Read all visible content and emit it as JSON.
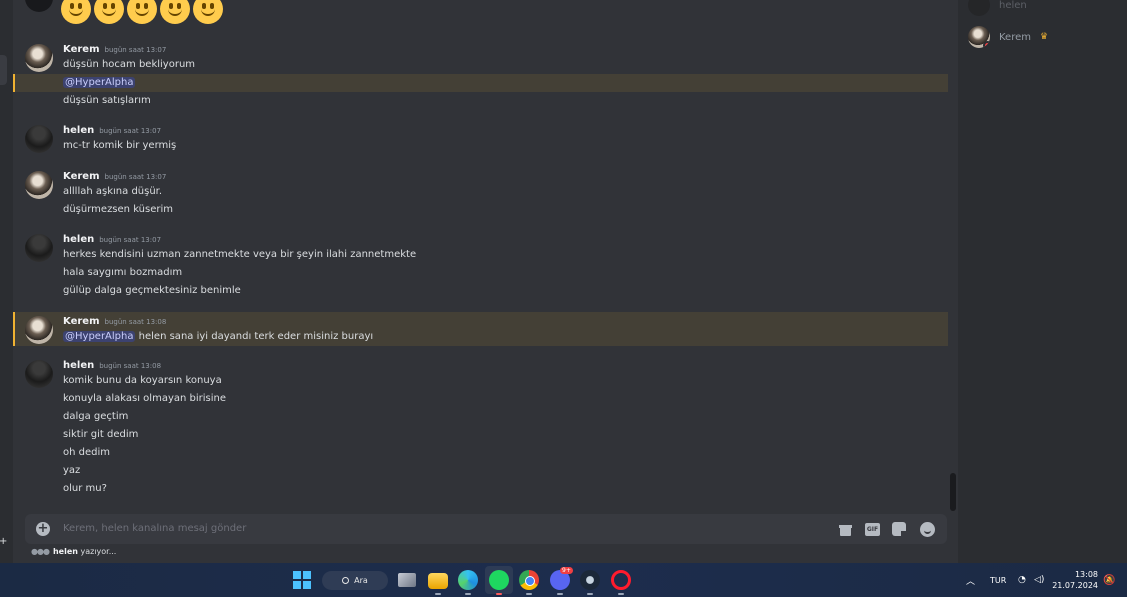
{
  "chat": {
    "emoji_count": 5,
    "messages": [
      {
        "author": "Kerem",
        "time": "bugün saat 13:07",
        "lines": [
          "düşsün hocam bekliyorum"
        ]
      },
      {
        "mention": "@HyperAlpha"
      },
      {
        "line": "düşsün satışlarım"
      },
      {
        "author": "helen",
        "time": "bugün saat 13:07",
        "lines": [
          "mc-tr komik bir yermiş"
        ]
      },
      {
        "author": "Kerem",
        "time": "bugün saat 13:07",
        "lines": [
          "allllah aşkına düşür.",
          "düşürmezsen küserim"
        ]
      },
      {
        "author": "helen",
        "time": "bugün saat 13:07",
        "lines": [
          "herkes kendisini uzman zannetmekte veya bir şeyin ilahi zannetmekte",
          "hala saygımı bozmadım",
          "gülüp dalga geçmektesiniz benimle"
        ]
      },
      {
        "author": "Kerem",
        "time": "bugün saat 13:08",
        "mention": "@HyperAlpha",
        "text": " helen sana iyi dayandı terk eder misiniz burayı"
      },
      {
        "author": "helen",
        "time": "bugün saat 13:08",
        "lines": [
          "komik bunu da koyarsın konuya",
          "konuyla alakası olmayan birisine",
          "dalga geçtim",
          "siktir git dedim",
          "oh dedim",
          "yaz",
          "olur mu?"
        ]
      }
    ]
  },
  "composer": {
    "placeholder": "Kerem, helen kanalına mesaj gönder",
    "gif_label": "GIF"
  },
  "typing": {
    "user": "helen",
    "text": " yazıyor..."
  },
  "members": [
    {
      "name": "helen",
      "faded": true
    },
    {
      "name": "Kerem",
      "crown": true,
      "status": "dnd"
    }
  ],
  "taskbar": {
    "search_label": "Ara",
    "discord_badge": "9+",
    "lang": "TUR",
    "time": "13:08",
    "date": "21.07.2024"
  },
  "colors": {
    "highlight": "#444036",
    "mention_bg": "#3c4270",
    "accent": "#f0b232"
  }
}
